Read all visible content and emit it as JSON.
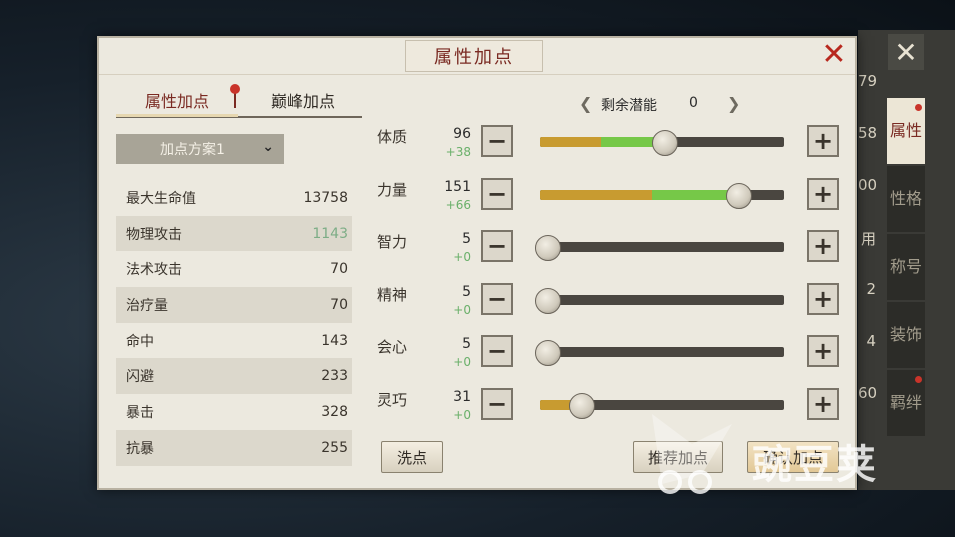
{
  "window": {
    "title": "属性加点"
  },
  "tabs": [
    {
      "label": "属性加点",
      "active": true
    },
    {
      "label": "巅峰加点",
      "active": false
    }
  ],
  "scheme": {
    "selected": "加点方案1"
  },
  "potential": {
    "label": "剩余潜能",
    "value": "0"
  },
  "stats": [
    {
      "label": "最大生命值",
      "value": "13758"
    },
    {
      "label": "物理攻击",
      "value": "1143"
    },
    {
      "label": "法术攻击",
      "value": "70"
    },
    {
      "label": "治疗量",
      "value": "70"
    },
    {
      "label": "命中",
      "value": "143"
    },
    {
      "label": "闪避",
      "value": "233"
    },
    {
      "label": "暴击",
      "value": "328"
    },
    {
      "label": "抗暴",
      "value": "255"
    }
  ],
  "attributes": [
    {
      "name": "体质",
      "value": "96",
      "bonus": "+38",
      "level": 0.51,
      "boost": 0.26
    },
    {
      "name": "力量",
      "value": "151",
      "bonus": "+66",
      "level": 0.81,
      "boost": 0.35
    },
    {
      "name": "智力",
      "value": "5",
      "bonus": "+0",
      "level": 0.03,
      "boost": 0
    },
    {
      "name": "精神",
      "value": "5",
      "bonus": "+0",
      "level": 0.03,
      "boost": 0
    },
    {
      "name": "会心",
      "value": "5",
      "bonus": "+0",
      "level": 0.03,
      "boost": 0
    },
    {
      "name": "灵巧",
      "value": "31",
      "bonus": "+0",
      "level": 0.17,
      "boost": 0
    }
  ],
  "buttons": {
    "reset": "洗点",
    "recommend": "推荐加点",
    "confirm": "确认加点",
    "minus": "−",
    "plus": "+",
    "close": "✕"
  },
  "side_tabs": [
    {
      "label": "属性",
      "active": true
    },
    {
      "label": "性格",
      "active": false
    },
    {
      "label": "称号",
      "active": false
    },
    {
      "label": "装饰",
      "active": false
    },
    {
      "label": "羁绊",
      "active": false
    }
  ],
  "background_numbers": [
    "79",
    "58",
    "00",
    "用",
    "2",
    "4",
    "60"
  ],
  "watermark": {
    "text": "豌豆荚"
  },
  "colors": {
    "slider_fill": "#c89b30",
    "slider_boost": "#76c848",
    "title_red": "#7a2a22",
    "close_red": "#b8281e",
    "bonus_green": "#6ab06a"
  }
}
